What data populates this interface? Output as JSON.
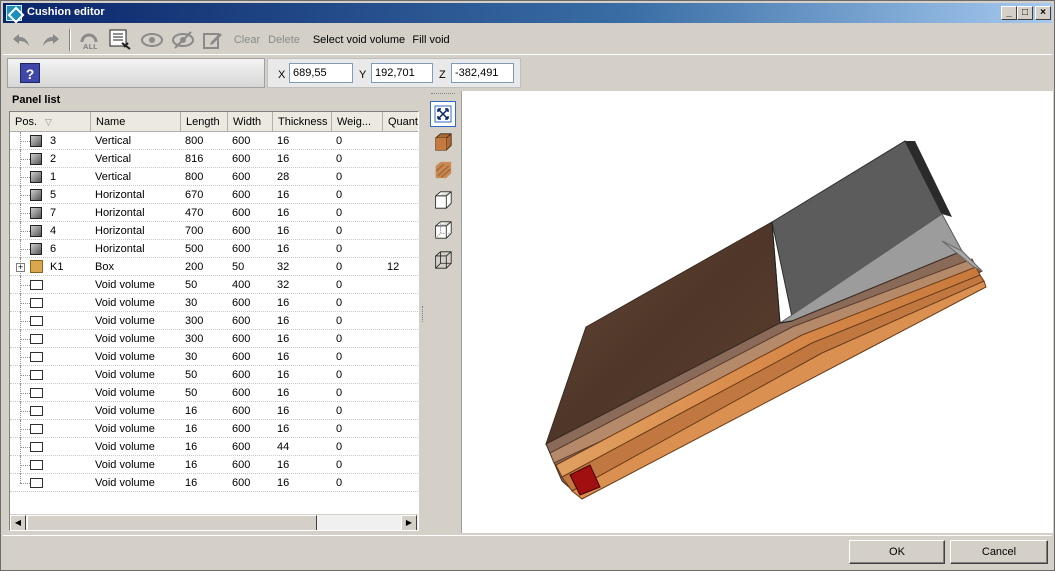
{
  "window": {
    "title": "Cushion editor"
  },
  "toolbar": {
    "clear_label": "Clear",
    "delete_label": "Delete",
    "select_void_label": "Select void volume",
    "fill_void_label": "Fill void",
    "icons": [
      "undo-icon",
      "redo-icon",
      "all-icon",
      "panel-list-icon",
      "show-icon",
      "hide-icon",
      "edit-icon"
    ]
  },
  "help": {
    "label": "?"
  },
  "coords": {
    "x_label": "X",
    "x_value": "689,55",
    "y_label": "Y",
    "y_value": "192,701",
    "z_label": "Z",
    "z_value": "-382,491"
  },
  "panel_list": {
    "title": "Panel list",
    "columns": [
      "Pos.",
      "Name",
      "Length",
      "Width",
      "Thickness",
      "Weig...",
      "Quant"
    ],
    "rows": [
      {
        "type": "panel",
        "pos": "3",
        "name": "Vertical",
        "length": "800",
        "width": "600",
        "thickness": "16",
        "weight": "0",
        "quantity": ""
      },
      {
        "type": "panel",
        "pos": "2",
        "name": "Vertical",
        "length": "816",
        "width": "600",
        "thickness": "16",
        "weight": "0",
        "quantity": ""
      },
      {
        "type": "panel",
        "pos": "1",
        "name": "Vertical",
        "length": "800",
        "width": "600",
        "thickness": "28",
        "weight": "0",
        "quantity": ""
      },
      {
        "type": "panel",
        "pos": "5",
        "name": "Horizontal",
        "length": "670",
        "width": "600",
        "thickness": "16",
        "weight": "0",
        "quantity": ""
      },
      {
        "type": "panel",
        "pos": "7",
        "name": "Horizontal",
        "length": "470",
        "width": "600",
        "thickness": "16",
        "weight": "0",
        "quantity": ""
      },
      {
        "type": "panel",
        "pos": "4",
        "name": "Horizontal",
        "length": "700",
        "width": "600",
        "thickness": "16",
        "weight": "0",
        "quantity": ""
      },
      {
        "type": "panel",
        "pos": "6",
        "name": "Horizontal",
        "length": "500",
        "width": "600",
        "thickness": "16",
        "weight": "0",
        "quantity": ""
      },
      {
        "type": "box",
        "pos": "K1",
        "name": "Box",
        "length": "200",
        "width": "50",
        "thickness": "32",
        "weight": "0",
        "quantity": "12"
      },
      {
        "type": "void",
        "pos": "",
        "name": "Void volume",
        "length": "50",
        "width": "400",
        "thickness": "32",
        "weight": "0",
        "quantity": ""
      },
      {
        "type": "void",
        "pos": "",
        "name": "Void volume",
        "length": "30",
        "width": "600",
        "thickness": "16",
        "weight": "0",
        "quantity": ""
      },
      {
        "type": "void",
        "pos": "",
        "name": "Void volume",
        "length": "300",
        "width": "600",
        "thickness": "16",
        "weight": "0",
        "quantity": ""
      },
      {
        "type": "void",
        "pos": "",
        "name": "Void volume",
        "length": "300",
        "width": "600",
        "thickness": "16",
        "weight": "0",
        "quantity": ""
      },
      {
        "type": "void",
        "pos": "",
        "name": "Void volume",
        "length": "30",
        "width": "600",
        "thickness": "16",
        "weight": "0",
        "quantity": ""
      },
      {
        "type": "void",
        "pos": "",
        "name": "Void volume",
        "length": "50",
        "width": "600",
        "thickness": "16",
        "weight": "0",
        "quantity": ""
      },
      {
        "type": "void",
        "pos": "",
        "name": "Void volume",
        "length": "50",
        "width": "600",
        "thickness": "16",
        "weight": "0",
        "quantity": ""
      },
      {
        "type": "void",
        "pos": "",
        "name": "Void volume",
        "length": "16",
        "width": "600",
        "thickness": "16",
        "weight": "0",
        "quantity": ""
      },
      {
        "type": "void",
        "pos": "",
        "name": "Void volume",
        "length": "16",
        "width": "600",
        "thickness": "16",
        "weight": "0",
        "quantity": ""
      },
      {
        "type": "void",
        "pos": "",
        "name": "Void volume",
        "length": "16",
        "width": "600",
        "thickness": "44",
        "weight": "0",
        "quantity": ""
      },
      {
        "type": "void",
        "pos": "",
        "name": "Void volume",
        "length": "16",
        "width": "600",
        "thickness": "16",
        "weight": "0",
        "quantity": ""
      },
      {
        "type": "void",
        "pos": "",
        "name": "Void volume",
        "length": "16",
        "width": "600",
        "thickness": "16",
        "weight": "0",
        "quantity": ""
      }
    ]
  },
  "view_toolbar": {
    "icons": [
      "zoom-extents-icon",
      "textured-view-icon",
      "material-view-icon",
      "wireframe-view-icon",
      "hidden-line-view-icon",
      "transparent-view-icon"
    ]
  },
  "colors": {
    "wood_dark": "#5a4030",
    "wood_light": "#d98a4a",
    "grey_panel": "#5a5a5a",
    "highlight_red": "#a01010"
  },
  "footer": {
    "ok_label": "OK",
    "cancel_label": "Cancel"
  }
}
